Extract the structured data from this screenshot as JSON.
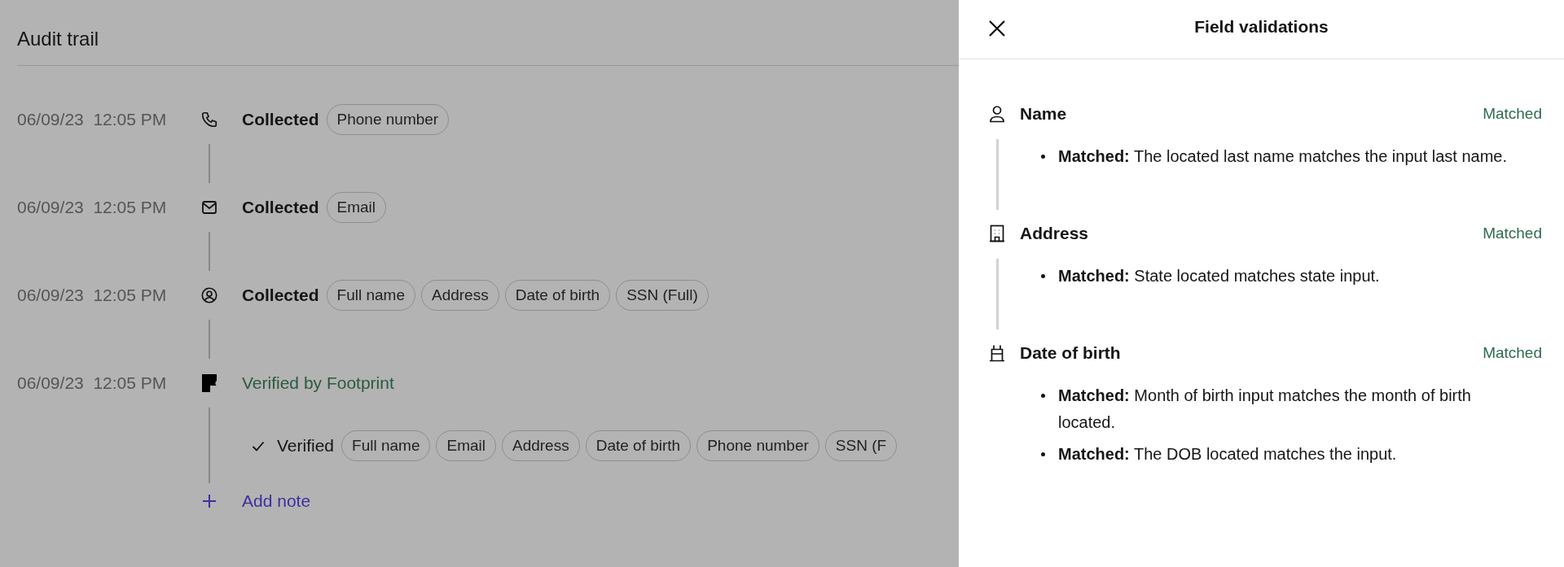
{
  "audit_trail": {
    "title": "Audit trail",
    "events": [
      {
        "time": "06/09/23",
        "clock": "12:05 PM",
        "kind": "phone",
        "label": "Collected",
        "chips": [
          "Phone number"
        ]
      },
      {
        "time": "06/09/23",
        "clock": "12:05 PM",
        "kind": "email",
        "label": "Collected",
        "chips": [
          "Email"
        ]
      },
      {
        "time": "06/09/23",
        "clock": "12:05 PM",
        "kind": "identity",
        "label": "Collected",
        "chips": [
          "Full name",
          "Address",
          "Date of birth",
          "SSN (Full)"
        ]
      },
      {
        "time": "06/09/23",
        "clock": "12:05 PM",
        "kind": "verification",
        "label": "Verified by Footprint",
        "verified": {
          "label": "Verified",
          "chips": [
            "Full name",
            "Email",
            "Address",
            "Date of birth",
            "Phone number",
            "SSN (F"
          ]
        }
      }
    ],
    "add_note": "Add note"
  },
  "drawer": {
    "title": "Field validations",
    "sections": [
      {
        "kind": "person",
        "label": "Name",
        "status": "Matched",
        "notes": [
          "**Matched:** The located last name matches the input last name."
        ]
      },
      {
        "kind": "building",
        "label": "Address",
        "status": "Matched",
        "notes": [
          "**Matched:** State located matches state input."
        ]
      },
      {
        "kind": "cake",
        "label": "Date of birth",
        "status": "Matched",
        "notes": [
          "**Matched:** Month of birth input matches the month of birth located.",
          "**Matched:** The DOB located matches the input."
        ]
      }
    ]
  }
}
